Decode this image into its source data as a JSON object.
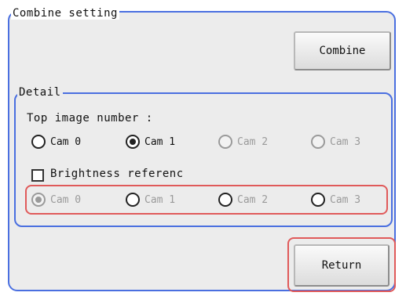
{
  "combine_setting": {
    "title": "Combine setting",
    "combine_button": "Combine"
  },
  "detail": {
    "title": "Detail",
    "top_image_label": "Top image number :",
    "top_image_options": [
      "Cam 0",
      "Cam 1",
      "Cam 2",
      "Cam 3"
    ],
    "top_image_selected": "Cam 1",
    "brightness_label": "Brightness referenc",
    "brightness_checked": false,
    "brightness_options": [
      "Cam 0",
      "Cam 1",
      "Cam 2",
      "Cam 3"
    ],
    "brightness_selected": "Cam 0"
  },
  "footer": {
    "return_button": "Return"
  },
  "colors": {
    "frame_border": "#4a6fe0",
    "highlight": "#e05a5a",
    "disabled_text": "#9a9a9a"
  }
}
